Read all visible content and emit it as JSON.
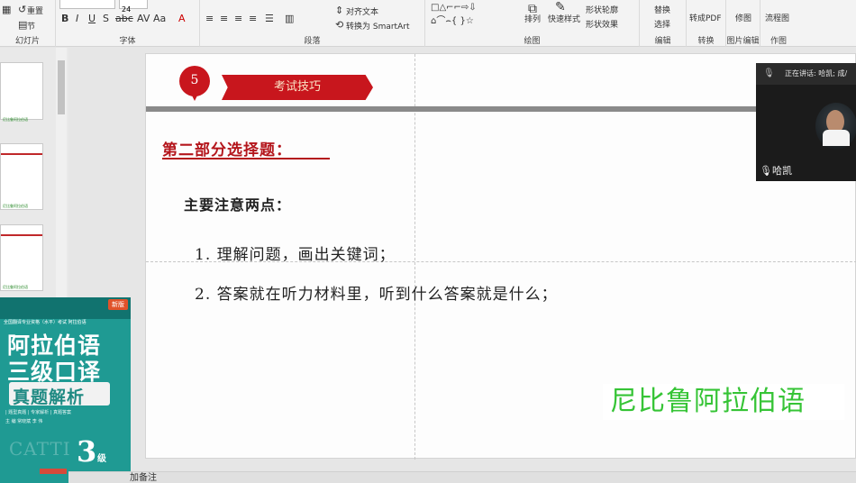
{
  "ribbon": {
    "slides_group": {
      "reset_label": "重置",
      "section_label": "节",
      "group_label": "幻灯片"
    },
    "font_group": {
      "font_size": "24",
      "group_label": "字体"
    },
    "paragraph_group": {
      "align_text_label": "对齐文本",
      "smartart_label": "转换为 SmartArt",
      "group_label": "段落"
    },
    "drawing_group": {
      "arrange_label": "排列",
      "quick_styles_label": "快速样式",
      "shape_outline_label": "形状轮廓",
      "shape_effects_label": "形状效果",
      "group_label": "绘图"
    },
    "editing_group": {
      "replace_label": "替换",
      "select_label": "选择",
      "group_label": "编辑"
    },
    "convert_group": {
      "pdf_label": "转成PDF",
      "group_label": "转换"
    },
    "image_edit_group": {
      "retouch_label": "修图",
      "group_label": "图片编辑"
    },
    "drawing2_group": {
      "flowchart_label": "流程图",
      "group_label": "作图"
    }
  },
  "thumbnails": [
    {
      "text": "尼比鲁阿拉伯语"
    },
    {
      "text": "尼比鲁阿拉伯语"
    },
    {
      "text": "尼比鲁阿拉伯语"
    }
  ],
  "book": {
    "badge": "新版",
    "series": "全国翻译专业资格（水平）考试 阿拉伯语",
    "title_line1": "阿拉伯语",
    "title_line2": "三级口译",
    "title_line3": "真题解析",
    "bullets": "| 题型真题  | 专家解析  | 真题答案",
    "authors": "主 编  常晓斌  李 伟",
    "watermark": "CATTI",
    "level": "3",
    "level_suffix": "级"
  },
  "slide": {
    "number": "5",
    "banner": "考试技巧",
    "section_heading": "第二部分选择题：",
    "points_title": "主要注意两点：",
    "item1": "1. 理解问题，画出关键词；",
    "item2": "2. 答案就在听力材料里，听到什么答案就是什么；",
    "watermark": "尼比鲁阿拉伯语"
  },
  "call": {
    "speaking": "正在讲话: 哈凯; 成/",
    "participant": "哈凯"
  },
  "notes": {
    "label": "加备注"
  },
  "colors": {
    "accent_red": "#c8161d",
    "book_teal": "#1f9a93",
    "watermark_green": "#36c436"
  }
}
